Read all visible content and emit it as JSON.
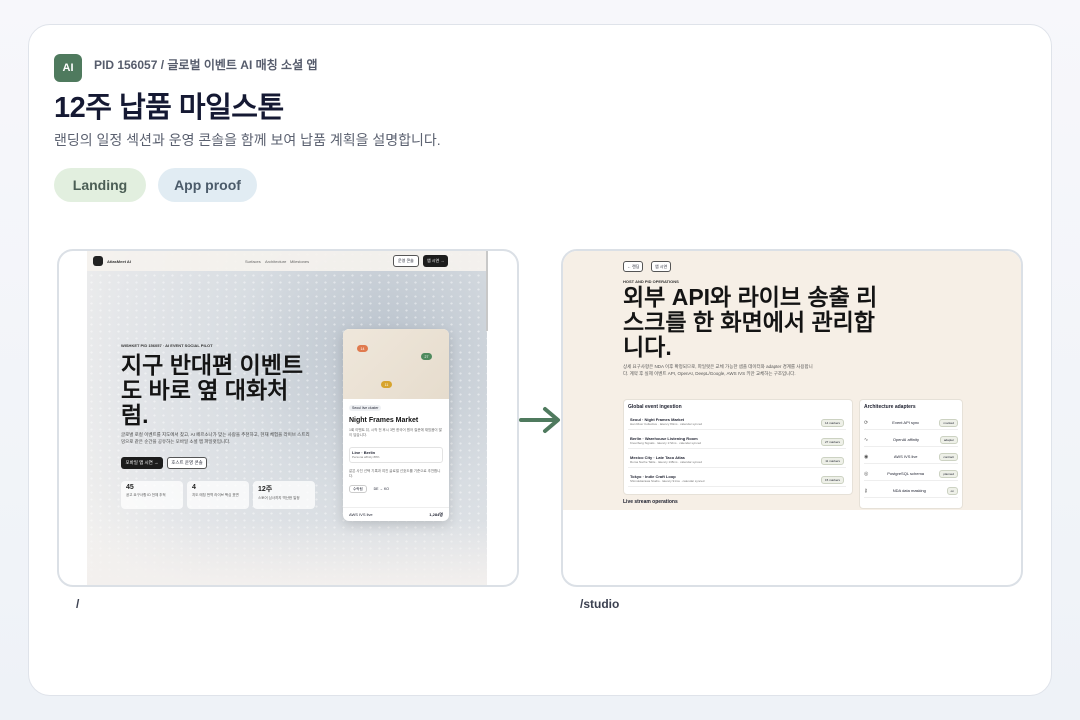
{
  "header": {
    "badge": "AI",
    "pid": "PID 156057 / 글로벌 이벤트 AI 매칭 소셜 앱",
    "title": "12주 납품 마일스톤",
    "subtitle": "랜딩의 일정 섹션과 운영 콘솔을 함께 보여 납품 계획을 설명합니다.",
    "tabs": [
      "Landing",
      "App proof"
    ]
  },
  "colors": {
    "accent": "#4f7a5e",
    "tab_landing": "#e2efdf",
    "tab_app": "#e1ecf3"
  },
  "routes": {
    "landing": "/",
    "studio": "/studio"
  },
  "landing": {
    "brand": "AtlasMeet AI",
    "nav": [
      "Surfaces",
      "Architecture",
      "Milestones"
    ],
    "nav_buttons": [
      "운영 콘솔",
      "앱 시연 →"
    ],
    "kicker": "WISHKET PID 156057 · AI EVENT SOCIAL PILOT",
    "headline": "지구 반대편 이벤트도 바로 옆 대화처럼.",
    "paragraph": "글로벌 로컬 이벤트를 지도에서 찾고, AI 페르소나가 맞는 사람을 추천하고, 현재 체험을 라이브 스트리밍으로 같은 순간을 공유하는 모바일 소셜 앱 파일럿입니다.",
    "buttons": [
      "모바일 앱 시연 →",
      "호스트 운영 콘솔"
    ],
    "stats": [
      {
        "value": "45",
        "label": "공고 요구사항 ID 전체 추적"
      },
      {
        "value": "4",
        "label": "지도 매칭 번역 라이브 핵심 표면"
      },
      {
        "value": "12주",
        "label": "스토어 심사까지 역산한 일정"
      }
    ],
    "card": {
      "pins": [
        "14",
        "27",
        "11"
      ],
      "tag": "Seoul live cluster",
      "title": "Night Frames Market",
      "desc": "1회 이벤트 뒤, 시작 전 후시 3번 한국어 원어 질문에 재밌음이 많이 답습니다.",
      "line": "Line · Berlin",
      "line_sub": "Persona affinity 88%",
      "desc2": "같은 사진 선택 기록과 여진 글로벌 선호도를 기준으로 추천합니다.",
      "chips": [
        "수락됨",
        "DE → KO"
      ],
      "footer_left": "AWS IVS live",
      "footer_right": "1,284명"
    }
  },
  "studio": {
    "buttons": [
      "← 랜딩",
      "앱 시연"
    ],
    "kicker": "HOST AND PID OPERATIONS",
    "headline": "외부 API와 라이브 송출 리스크를 한 화면에서 관리합니다.",
    "paragraph": "상세 요구사항은 NDA 이후 확정되므로, 파일럿은 교체 가능한 샘플 데이터와 adapter 경계를 사용합니다. 계약 후 실제 이벤트 API, OpenAI, DeepL/Google, AWS IVS 키만 교체하는 구조입니다.",
    "ingestion": {
      "title": "Global event ingestion",
      "events": [
        {
          "name": "Seoul · Night Frames Market",
          "meta": "Han River Collective · latency 84ms · calendar synced",
          "badge": "14 markers"
        },
        {
          "name": "Berlin · Warehouse Listening Room",
          "meta": "Kreuzberg Signals · latency 172ms · calendar synced",
          "badge": "27 markers"
        },
        {
          "name": "Mexico City · Late Taco Atlas",
          "meta": "Roma Noche Table · latency 138ms · calendar synced",
          "badge": "11 markers"
        },
        {
          "name": "Tokyo · Indie Craft Loop",
          "meta": "Shimokitazawa Studio · latency 91ms · calendar synced",
          "badge": "15 markers"
        }
      ]
    },
    "adapters": {
      "title": "Architecture adapters",
      "items": [
        {
          "icon": "sync-icon",
          "name": "Event API sync",
          "status": "mocked"
        },
        {
          "icon": "pulse-icon",
          "name": "OpenAI affinity",
          "status": "adapter"
        },
        {
          "icon": "broadcast-icon",
          "name": "AWS IVS live",
          "status": "contract"
        },
        {
          "icon": "database-icon",
          "name": "PostgreSQL schema",
          "status": "planned"
        },
        {
          "icon": "key-icon",
          "name": "NDA data masking",
          "status": "on"
        }
      ]
    },
    "live_title": "Live stream operations"
  }
}
